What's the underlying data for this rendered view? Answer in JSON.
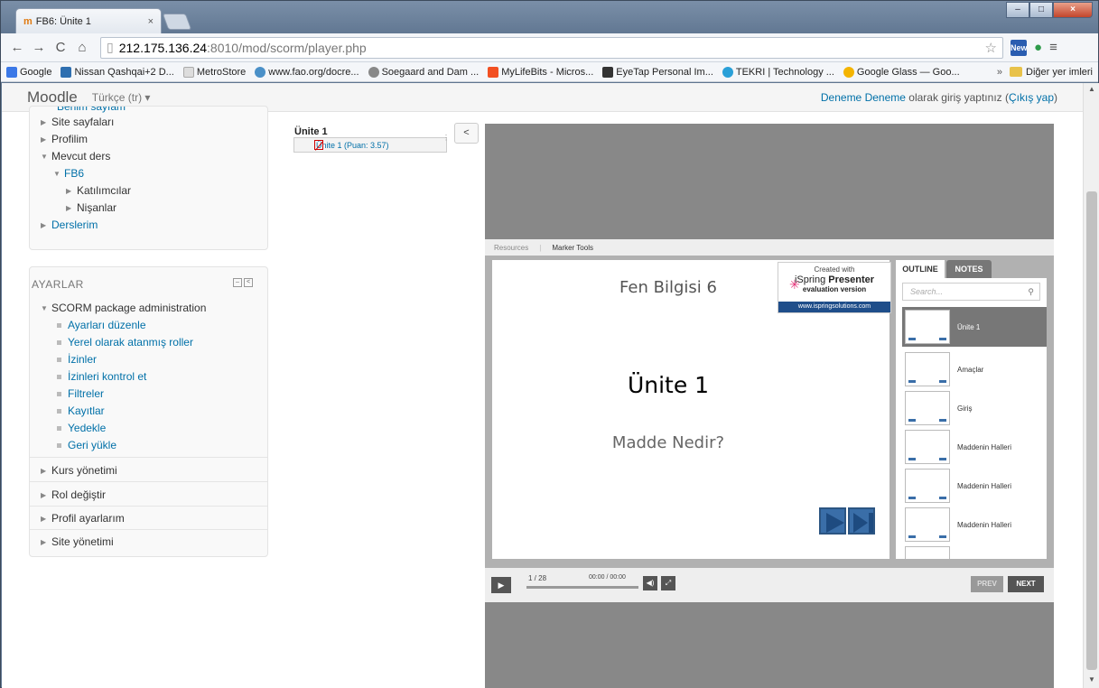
{
  "browser": {
    "tab_title": "FB6: Ünite 1",
    "tab_close": "×",
    "url_host": "212.175.136.24",
    "url_rest": ":8010/mod/scorm/player.php",
    "ext_badge": "New",
    "bookmarks": [
      {
        "label": "Google",
        "color": "#3b78e7"
      },
      {
        "label": "Nissan Qashqai+2 D...",
        "color": "#2e6fb0"
      },
      {
        "label": "MetroStore",
        "color": "#cccccc"
      },
      {
        "label": "www.fao.org/docre...",
        "color": "#4a90c8"
      },
      {
        "label": "Soegaard and Dam ...",
        "color": "#888888"
      },
      {
        "label": "MyLifeBits - Micros...",
        "color": "#f25022"
      },
      {
        "label": "EyeTap Personal Im...",
        "color": "#333333"
      },
      {
        "label": "TEKRI | Technology ...",
        "color": "#2aa0d8"
      },
      {
        "label": "Google Glass — Goo...",
        "color": "#f4b400"
      }
    ],
    "bookmarks_more": "»",
    "other_bookmarks": "Diğer yer imleri"
  },
  "moodle": {
    "brand": "Moodle",
    "lang": "Türkçe (tr) ▾",
    "login_prefix": "Deneme Deneme",
    "login_middle": " olarak giriş yaptınız (",
    "logout": "Çıkış yap",
    "login_suffix": ")"
  },
  "nav_block": {
    "cut_item": "Benim sayfam",
    "items": [
      "Site sayfaları",
      "Profilim",
      "Mevcut ders",
      "FB6",
      "Katılımcılar",
      "Nişanlar",
      "Derslerim"
    ]
  },
  "settings_block": {
    "title": "AYARLAR",
    "scorm_admin": "SCORM package administration",
    "scorm_items": [
      "Ayarları düzenle",
      "Yerel olarak atanmış roller",
      "İzinler",
      "İzinleri kontrol et",
      "Filtreler",
      "Kayıtlar",
      "Yedekle",
      "Geri yükle"
    ],
    "sections": [
      "Kurs yönetimi",
      "Rol değiştir",
      "Profil ayarlarım",
      "Site yönetimi"
    ]
  },
  "toc": {
    "title": "Ünite 1",
    "item": "Ünite 1 (Puan: 3.57)",
    "collapse": "<"
  },
  "player": {
    "tools": [
      "Resources",
      "Marker Tools"
    ],
    "slide_header": "Fen Bilgisi 6",
    "slide_title": "Ünite 1",
    "slide_subtitle": "Madde Nedir?",
    "watermark": {
      "line1": "Created with",
      "line2a": "iSpring ",
      "line2b": "Presenter",
      "line3": "evaluation version",
      "line4": "www.ispringsolutions.com"
    },
    "outline_tab": "OUTLINE",
    "notes_tab": "NOTES",
    "search_placeholder": "Search...",
    "outline_items": [
      "Ünite 1",
      "Amaçlar",
      "Giriş",
      "Maddenin Halleri",
      "Maddenin Halleri",
      "Maddenin Halleri"
    ],
    "slide_counter": "1 / 28",
    "time": "00:00 / 00:00",
    "prev": "PREV",
    "next": "NEXT"
  }
}
